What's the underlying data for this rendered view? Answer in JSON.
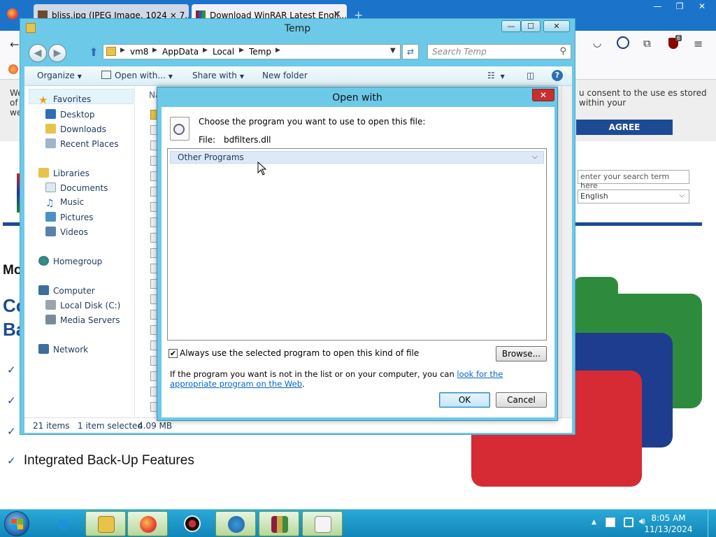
{
  "firefox": {
    "tabs": [
      {
        "title": "bliss.jpg (JPEG Image, 1024 × 7..."
      },
      {
        "title": "Download WinRAR Latest Engli..."
      }
    ],
    "new_tab": "+",
    "close_glyph": "✕",
    "toolbar_icons": [
      "back-arrow-icon",
      "pocket-icon",
      "account-icon",
      "extensions-icon",
      "ublock-icon",
      "menu-icon"
    ],
    "ublock_badge": "6",
    "window_controls": {
      "minimize": "—",
      "restore": "❐",
      "close": "✕"
    }
  },
  "webpage": {
    "cookie_left": "We of we",
    "cookie_text": "u consent to the use es stored within your",
    "agree_button": "AGREE",
    "search_placeholder": "enter your search term here",
    "language": "English",
    "heading_partial_1": "Mo",
    "heading_partial_2": "Co",
    "heading_partial_3": "Ba",
    "feature": "Integrated Back-Up Features",
    "check_glyph": "✓",
    "brand_colors": {
      "blue": "#1d4a94",
      "green": "#2e8b3e",
      "navy": "#1e3d8f",
      "red": "#d62b35"
    }
  },
  "explorer": {
    "title": "Temp",
    "window_controls": {
      "minimize": "—",
      "maximize": "☐",
      "close": "✕"
    },
    "breadcrumb": [
      "vm8",
      "AppData",
      "Local",
      "Temp"
    ],
    "search_placeholder": "Search Temp",
    "commands": {
      "organize": "Organize",
      "open_with": "Open with...",
      "share_with": "Share with",
      "new_folder": "New folder"
    },
    "nav": {
      "favorites": "Favorites",
      "desktop": "Desktop",
      "downloads": "Downloads",
      "recent_places": "Recent Places",
      "libraries": "Libraries",
      "documents": "Documents",
      "music": "Music",
      "pictures": "Pictures",
      "videos": "Videos",
      "homegroup": "Homegroup",
      "computer": "Computer",
      "local_disk": "Local Disk (C:)",
      "media_servers": "Media Servers",
      "network": "Network"
    },
    "column_name": "Na",
    "status": {
      "item_count": "21 items",
      "selection": "1 item selected",
      "size": "4.09 MB"
    }
  },
  "open_with": {
    "title": "Open with",
    "close": "✕",
    "prompt": "Choose the program you want to use to open this file:",
    "file_label": "File:",
    "file_name": "bdfilters.dll",
    "group_header": "Other Programs",
    "always_use_checked": "✔",
    "always_use_label": "Always use the selected program to open this kind of file",
    "browse_button": "Browse...",
    "info_text": "If the program you want is not in the list or on your computer, you can ",
    "info_link": "look for the appropriate program on the Web",
    "info_end": ".",
    "ok_button": "OK",
    "cancel_button": "Cancel"
  },
  "taskbar": {
    "pinned": [
      "internet-explorer-icon",
      "file-explorer-icon",
      "firefox-icon",
      "media-app-icon",
      "download-manager-icon",
      "winrar-icon",
      "task-list-icon"
    ],
    "tray_chevron": "▲",
    "clock_time": "8:05 AM",
    "clock_date": "11/13/2024"
  }
}
